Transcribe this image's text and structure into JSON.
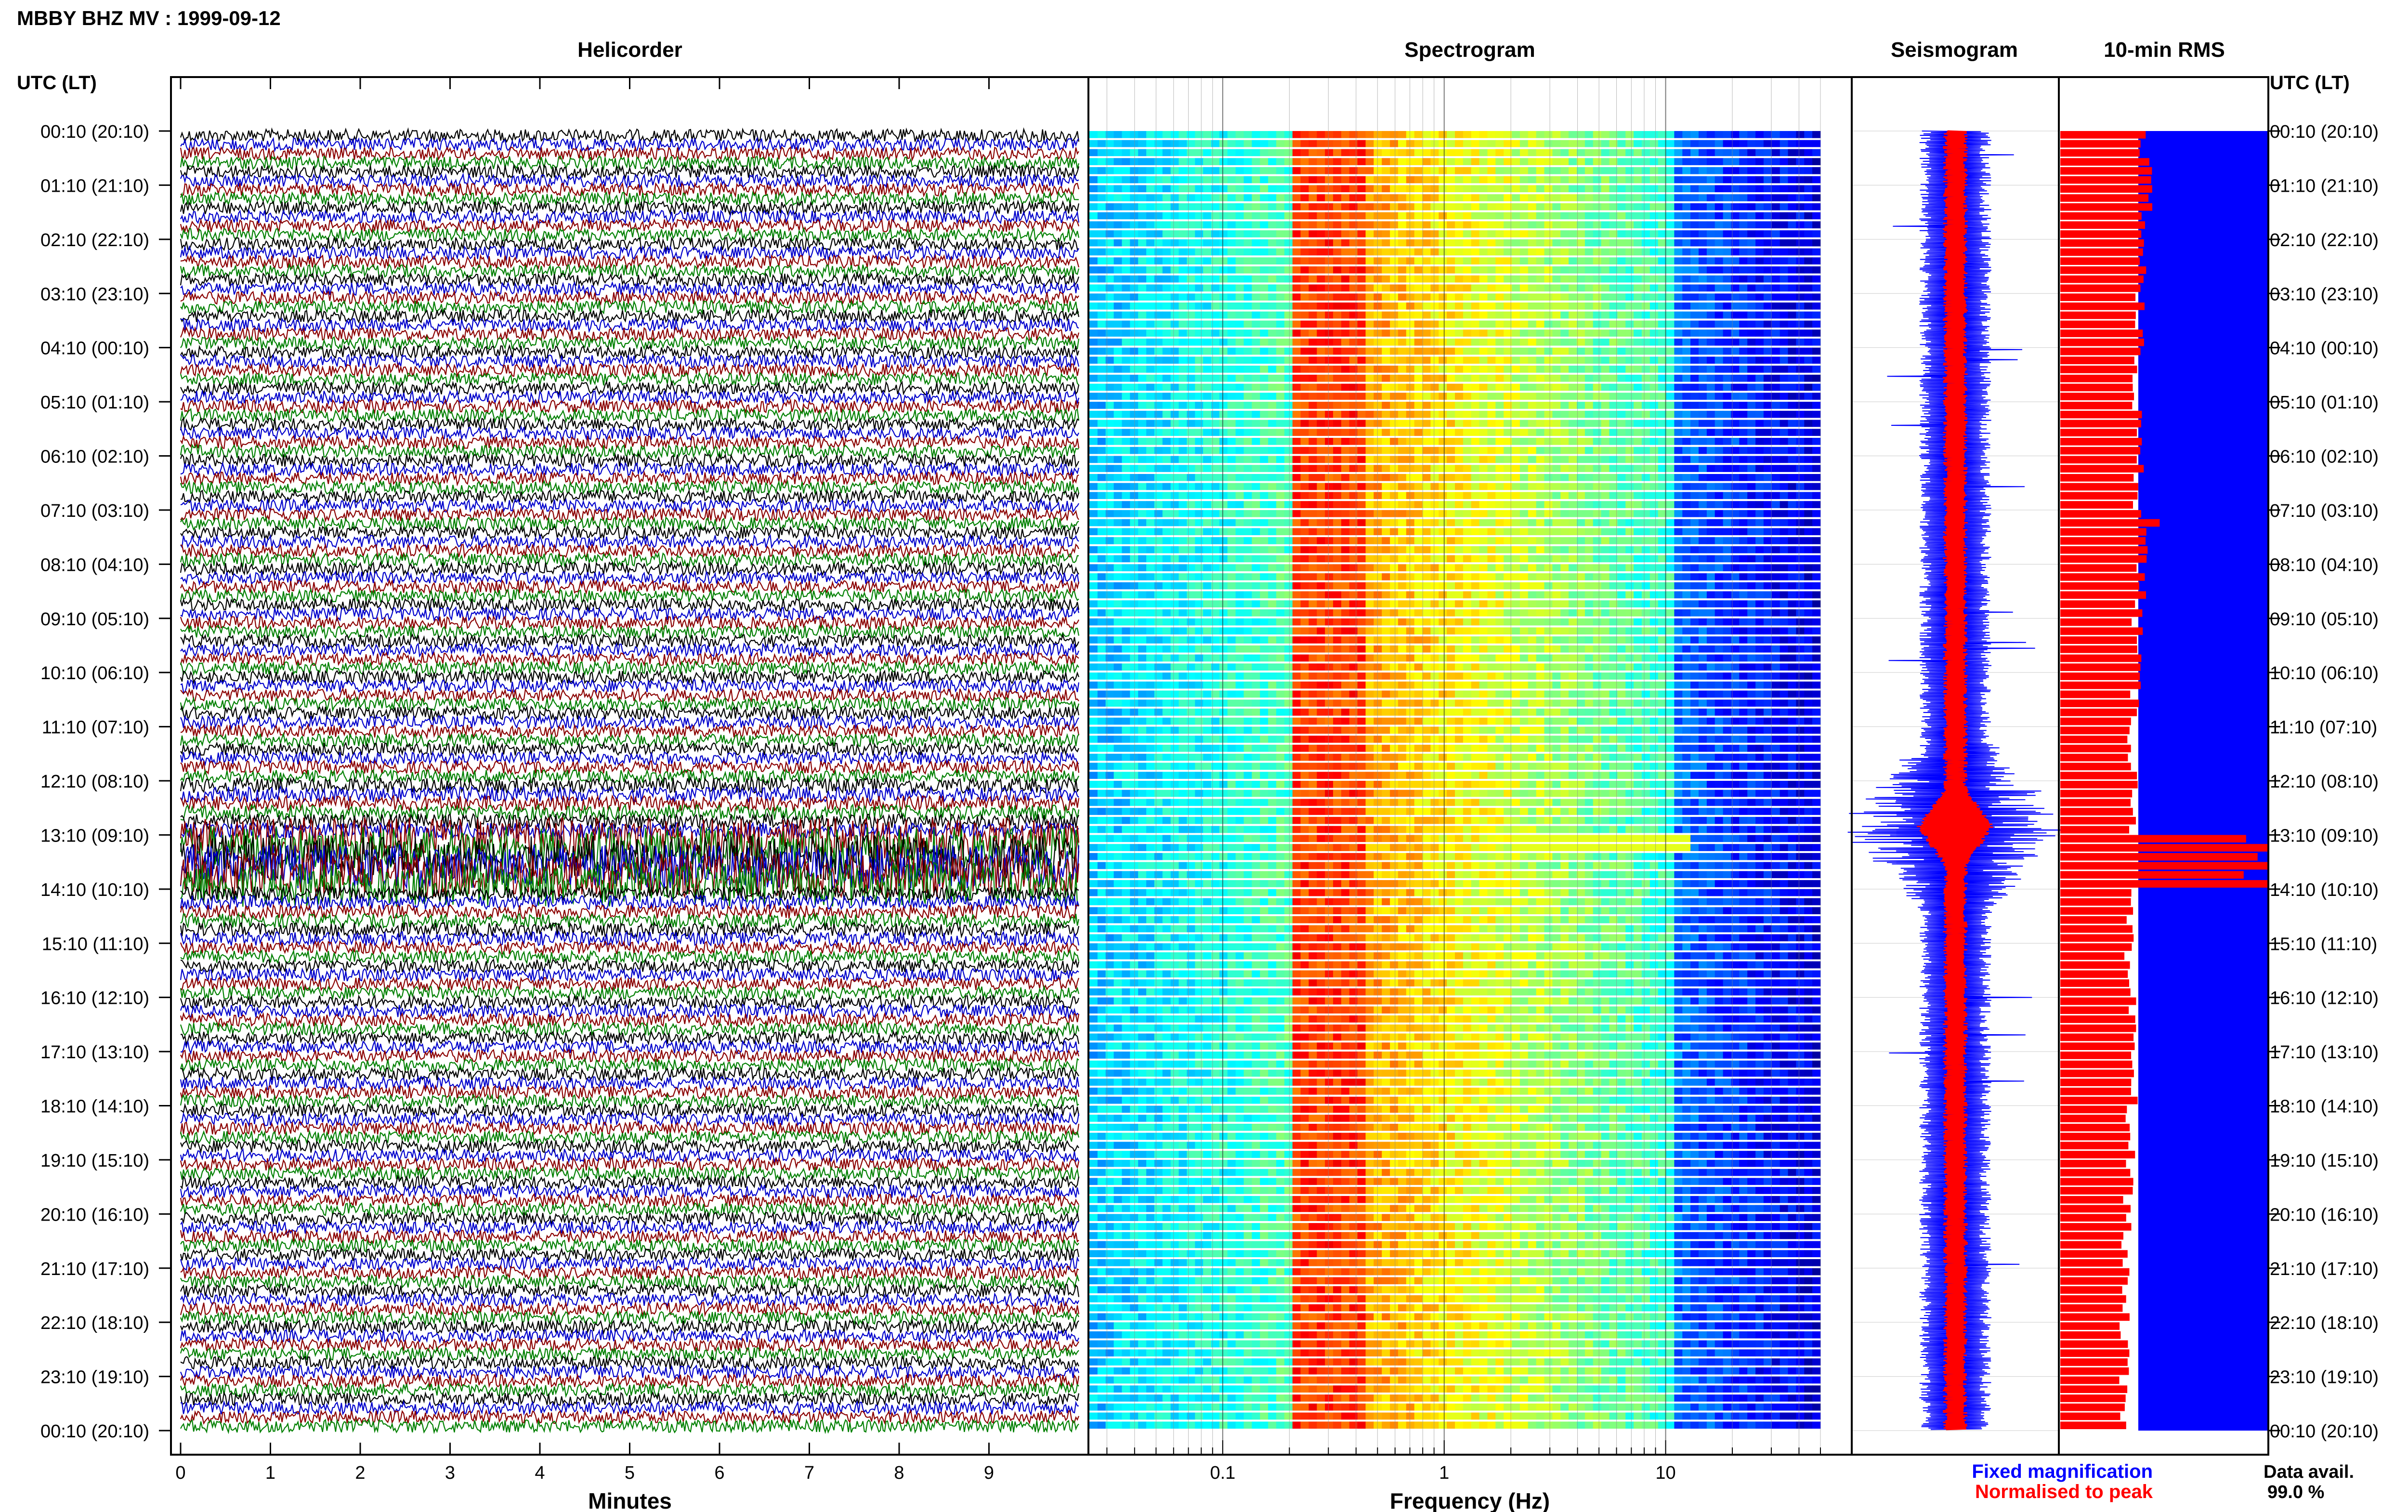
{
  "header": {
    "title": "MBBY BHZ MV : 1999-09-12",
    "time_label_left": "UTC (LT)",
    "time_label_right": "UTC (LT)"
  },
  "panels": {
    "helicorder": "Helicorder",
    "spectrogram": "Spectrogram",
    "seismogram": "Seismogram",
    "rms": "10-min RMS"
  },
  "legend": {
    "fixed": "Fixed magnification",
    "normalised": "Normalised to peak",
    "data_avail_label": "Data avail.",
    "data_avail_value": "99.0 %"
  },
  "colors": {
    "fixed": "#0000ff",
    "normalised": "#ff0000",
    "trace_cycle": [
      "#000000",
      "#0000cc",
      "#8b0000",
      "#008000"
    ]
  },
  "chart_data": [
    {
      "type": "line",
      "panel": "helicorder",
      "xlabel": "Minutes",
      "x_ticks": [
        "0",
        "1",
        "2",
        "3",
        "4",
        "5",
        "6",
        "7",
        "8",
        "9"
      ],
      "xlim": [
        0,
        10
      ],
      "rows_per_hour": 6,
      "hour_labels": [
        "00:10 (20:10)",
        "01:10 (21:10)",
        "02:10 (22:10)",
        "03:10 (23:10)",
        "04:10 (00:10)",
        "05:10 (01:10)",
        "06:10 (02:10)",
        "07:10 (03:10)",
        "08:10 (04:10)",
        "09:10 (05:10)",
        "10:10 (06:10)",
        "11:10 (07:10)",
        "12:10 (08:10)",
        "13:10 (09:10)",
        "14:10 (10:10)",
        "15:10 (11:10)",
        "16:10 (12:10)",
        "17:10 (13:10)",
        "18:10 (14:10)",
        "19:10 (15:10)",
        "20:10 (16:10)",
        "21:10 (17:10)",
        "22:10 (18:10)",
        "23:10 (19:10)",
        "00:10 (20:10)"
      ],
      "trace_amplitude": [
        1,
        1,
        1,
        1,
        1,
        1,
        1,
        1,
        1,
        1,
        1,
        1,
        1.2,
        3.5,
        1.1,
        1,
        1,
        1,
        1,
        1,
        1,
        1,
        1,
        1
      ]
    },
    {
      "type": "heatmap",
      "panel": "spectrogram",
      "xlabel": "Frequency (Hz)",
      "x_scale": "log",
      "xlim": [
        0.025,
        50
      ],
      "x_ticks": [
        "0.1",
        "1",
        "10"
      ],
      "dominant_band_hz": [
        0.2,
        0.45
      ],
      "colormap": "jet"
    },
    {
      "type": "line",
      "panel": "seismogram",
      "series": [
        {
          "name": "Fixed magnification",
          "color": "#0000ff"
        },
        {
          "name": "Normalised to peak",
          "color": "#ff0000"
        }
      ],
      "peak_hour": "13:10 (09:10)"
    },
    {
      "type": "bar",
      "panel": "rms",
      "title": "10-min RMS",
      "orientation": "horizontal",
      "rows": 144,
      "hourly_relative_rms": [
        0.41,
        0.42,
        0.4,
        0.38,
        0.37,
        0.37,
        0.38,
        0.4,
        0.39,
        0.37,
        0.36,
        0.35,
        0.36,
        0.95,
        0.33,
        0.32,
        0.34,
        0.35,
        0.34,
        0.33,
        0.32,
        0.31,
        0.31,
        0.3
      ],
      "spikes": [
        {
          "hour_index": 13,
          "value": 1.0
        },
        {
          "hour_index": 7,
          "value": 0.48
        }
      ]
    }
  ]
}
